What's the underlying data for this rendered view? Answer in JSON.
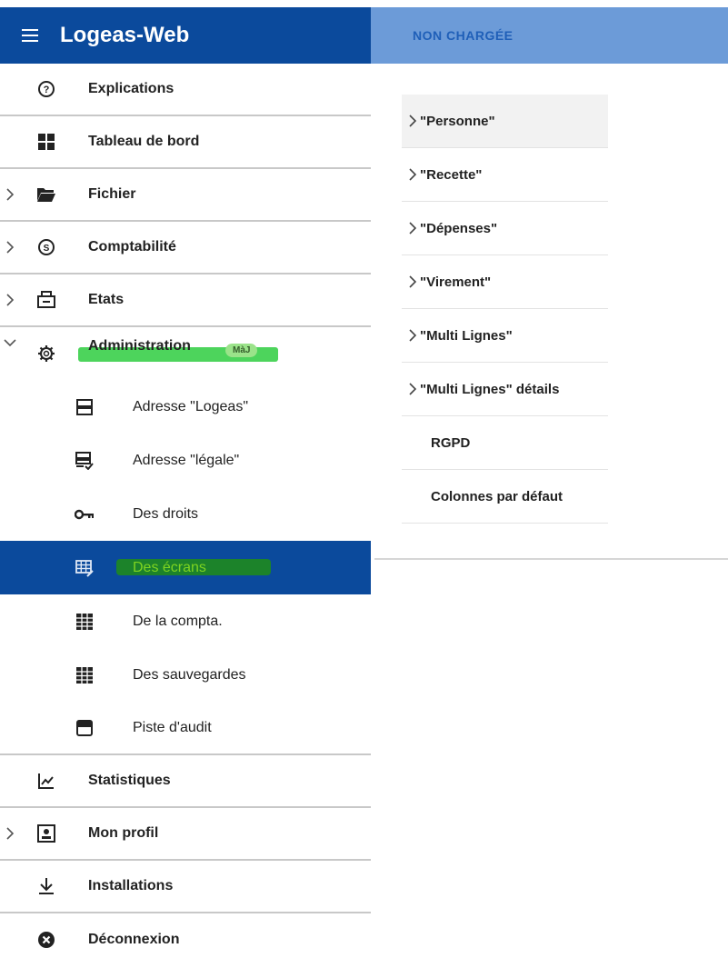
{
  "header": {
    "app_title": "Logeas-Web",
    "status": "NON CHARGÉE"
  },
  "sidebar": {
    "items": [
      {
        "label": "Explications",
        "icon": "help-circle-icon"
      },
      {
        "label": "Tableau de bord",
        "icon": "dashboard-icon"
      },
      {
        "label": "Fichier",
        "icon": "folder-open-icon"
      },
      {
        "label": "Comptabilité",
        "icon": "dollar-circle-icon"
      },
      {
        "label": "Etats",
        "icon": "print-icon"
      },
      {
        "label": "Administration",
        "icon": "gear-icon",
        "badge": "MàJ",
        "expanded": true
      },
      {
        "label": "Statistiques",
        "icon": "chart-line-icon"
      },
      {
        "label": "Mon profil",
        "icon": "profile-card-icon"
      },
      {
        "label": "Installations",
        "icon": "download-icon"
      },
      {
        "label": "Déconnexion",
        "icon": "cancel-circle-icon"
      }
    ],
    "admin_subitems": [
      {
        "label": "Adresse \"Logeas\"",
        "icon": "server-icon"
      },
      {
        "label": "Adresse \"légale\"",
        "icon": "server-check-icon"
      },
      {
        "label": "Des droits",
        "icon": "key-icon"
      },
      {
        "label": "Des écrans",
        "icon": "grid-edit-icon",
        "active": true
      },
      {
        "label": "De la compta.",
        "icon": "grid-icon"
      },
      {
        "label": "Des sauvegardes",
        "icon": "grid-icon"
      },
      {
        "label": "Piste d'audit",
        "icon": "window-icon"
      }
    ]
  },
  "panel": {
    "items": [
      {
        "label": "\"Personne\"",
        "expandable": true
      },
      {
        "label": "\"Recette\"",
        "expandable": true
      },
      {
        "label": "\"Dépenses\"",
        "expandable": true
      },
      {
        "label": "\"Virement\"",
        "expandable": true
      },
      {
        "label": "\"Multi Lignes\"",
        "expandable": true
      },
      {
        "label": "\"Multi Lignes\" détails",
        "expandable": true
      },
      {
        "label": "RGPD",
        "expandable": false
      },
      {
        "label": "Colonnes par défaut",
        "expandable": false
      }
    ]
  },
  "colors": {
    "primary": "#0b4a9c",
    "secondary_bar": "#6c9bd8",
    "highlight": "#2ecc40",
    "active_text": "#7ed321"
  }
}
